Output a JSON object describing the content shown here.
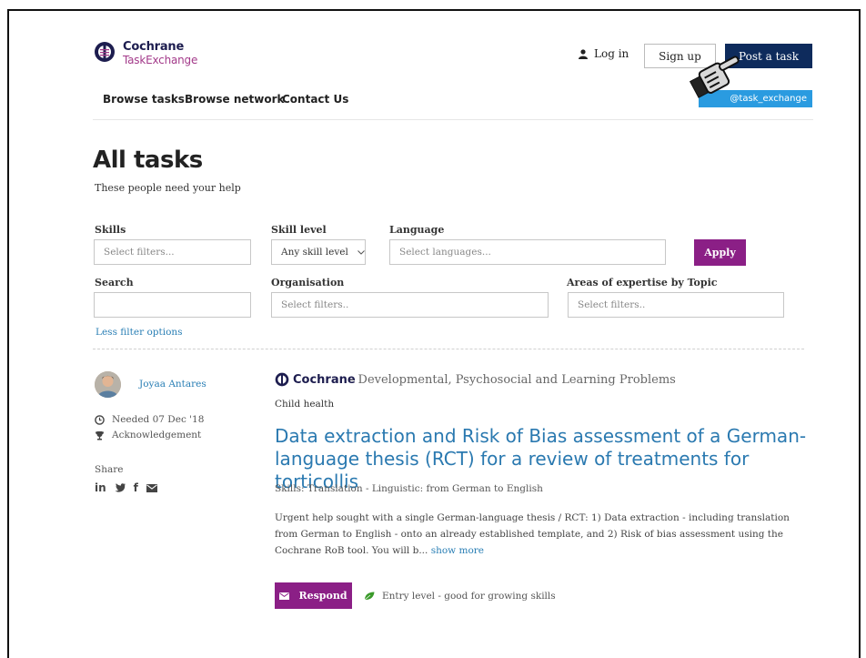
{
  "header": {
    "logo_line1": "Cochrane",
    "logo_line2": "TaskExchange",
    "login": "Log in",
    "signup": "Sign up",
    "post_task": "Post a task",
    "twitter_handle": "@task_exchange"
  },
  "nav": [
    "Browse tasks",
    "Browse network",
    "Contact Us"
  ],
  "page": {
    "title": "All tasks",
    "subtitle": "These people need your help"
  },
  "filters": {
    "skills_label": "Skills",
    "skills_placeholder": "Select filters...",
    "skill_level_label": "Skill level",
    "skill_level_value": "Any skill level",
    "language_label": "Language",
    "language_placeholder": "Select languages...",
    "apply": "Apply",
    "search_label": "Search",
    "search_value": "",
    "organisation_label": "Organisation",
    "organisation_placeholder": "Select filters..",
    "areas_label": "Areas of expertise by Topic",
    "areas_placeholder": "Select filters..",
    "less_options": "Less filter options"
  },
  "task": {
    "author": "Joyaa Antares",
    "needed": "Needed 07 Dec '18",
    "reward": "Acknowledgement",
    "share_label": "Share",
    "org_name": "Cochrane",
    "org_group": "- Developmental, Psychosocial and Learning Problems",
    "topic": "Child health",
    "title": "Data extraction and Risk of Bias assessment of a German-language thesis (RCT) for a review of treatments for torticollis",
    "skills": "Skills: Translation - Linguistic: from German to English",
    "description": "Urgent help sought with a single German-language thesis / RCT: 1) Data extraction - including translation from German to English - onto an already established template, and 2) Risk of bias assessment using the Cochrane RoB tool. You will b...",
    "show_more": "show more",
    "respond": "Respond",
    "level": "Entry level - good for growing skills"
  },
  "colors": {
    "navy": "#0e2b5c",
    "purple": "#8b1f86",
    "link_blue": "#2a7fb5",
    "twitter_blue": "#2a9be0"
  }
}
